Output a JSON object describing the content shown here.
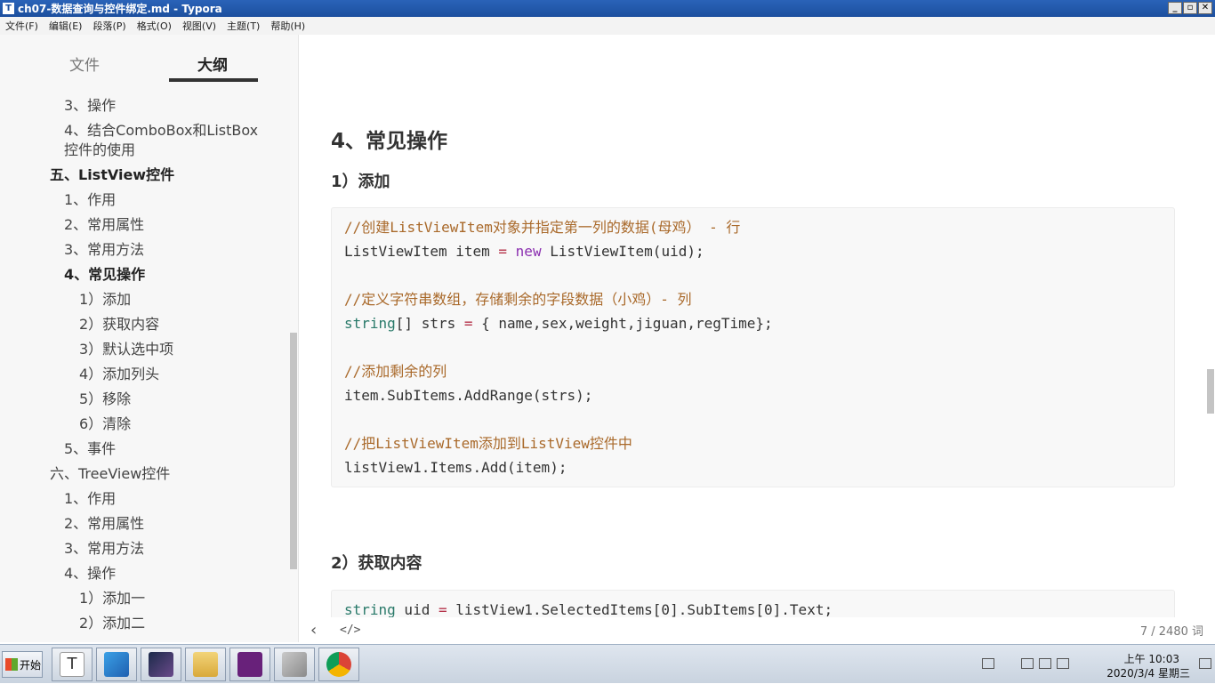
{
  "window": {
    "title": "ch07-数据查询与控件绑定.md - Typora",
    "app_icon_letter": "T",
    "min": "_",
    "max": "▫",
    "close": "✕"
  },
  "menu": [
    "文件(F)",
    "编辑(E)",
    "段落(P)",
    "格式(O)",
    "视图(V)",
    "主题(T)",
    "帮助(H)"
  ],
  "sidebar": {
    "tab_file": "文件",
    "tab_outline": "大纲",
    "items": [
      {
        "label": "3、操作",
        "level": 2,
        "bold": false
      },
      {
        "label": "4、结合ComboBox和ListBox控件的使用",
        "level": 2,
        "bold": false
      },
      {
        "label": "五、ListView控件",
        "level": 1,
        "bold": true
      },
      {
        "label": "1、作用",
        "level": 2,
        "bold": false
      },
      {
        "label": "2、常用属性",
        "level": 2,
        "bold": false
      },
      {
        "label": "3、常用方法",
        "level": 2,
        "bold": false
      },
      {
        "label": "4、常见操作",
        "level": 2,
        "bold": true
      },
      {
        "label": "1）添加",
        "level": 3,
        "bold": false
      },
      {
        "label": "2）获取内容",
        "level": 3,
        "bold": false
      },
      {
        "label": "3）默认选中项",
        "level": 3,
        "bold": false
      },
      {
        "label": "4）添加列头",
        "level": 3,
        "bold": false
      },
      {
        "label": "5）移除",
        "level": 3,
        "bold": false
      },
      {
        "label": "6）清除",
        "level": 3,
        "bold": false
      },
      {
        "label": "5、事件",
        "level": 2,
        "bold": false
      },
      {
        "label": "六、TreeView控件",
        "level": 1,
        "bold": false
      },
      {
        "label": "1、作用",
        "level": 2,
        "bold": false
      },
      {
        "label": "2、常用属性",
        "level": 2,
        "bold": false
      },
      {
        "label": "3、常用方法",
        "level": 2,
        "bold": false
      },
      {
        "label": "4、操作",
        "level": 2,
        "bold": false
      },
      {
        "label": "1）添加一",
        "level": 3,
        "bold": false
      },
      {
        "label": "2）添加二",
        "level": 3,
        "bold": false
      }
    ]
  },
  "content": {
    "h2": "4、常见操作",
    "h3_add": "1）添加",
    "h3_get": "2）获取内容",
    "code1": {
      "comment1": "//创建ListViewItem对象并指定第一列的数据(母鸡） - 行",
      "line1_type": "ListViewItem",
      "line1_var": " item ",
      "line1_eq": "=",
      "line1_new": "new",
      "line1_rest": " ListViewItem(uid);",
      "comment2": "//定义字符串数组，存储剩余的字段数据（小鸡）- 列",
      "line2_type": "string",
      "line2_rest": "[] strs ",
      "line2_eq": "=",
      "line2_tail": " { name,sex,weight,jiguan,regTime};",
      "comment3": "//添加剩余的列",
      "line3": "item.SubItems.AddRange(strs);",
      "comment4": "//把ListViewItem添加到ListView控件中",
      "line4": "listView1.Items.Add(item);"
    },
    "code2": {
      "line1_type": "string",
      "line1_rest": " uid ",
      "line1_eq": "=",
      "line1_tail": " listView1.SelectedItems[0].SubItems[0].Text;"
    }
  },
  "status": {
    "back": "‹",
    "source": "</>",
    "word_count": "7 / 2480 词"
  },
  "taskbar": {
    "start": "开始",
    "time": "上午 10:03",
    "date": "2020/3/4 星期三"
  },
  "colors": {
    "comment": "#a9692a",
    "keyword": "#8b2fb0",
    "type": "#2a7a6a",
    "titlebar": "#1c4f9e"
  }
}
